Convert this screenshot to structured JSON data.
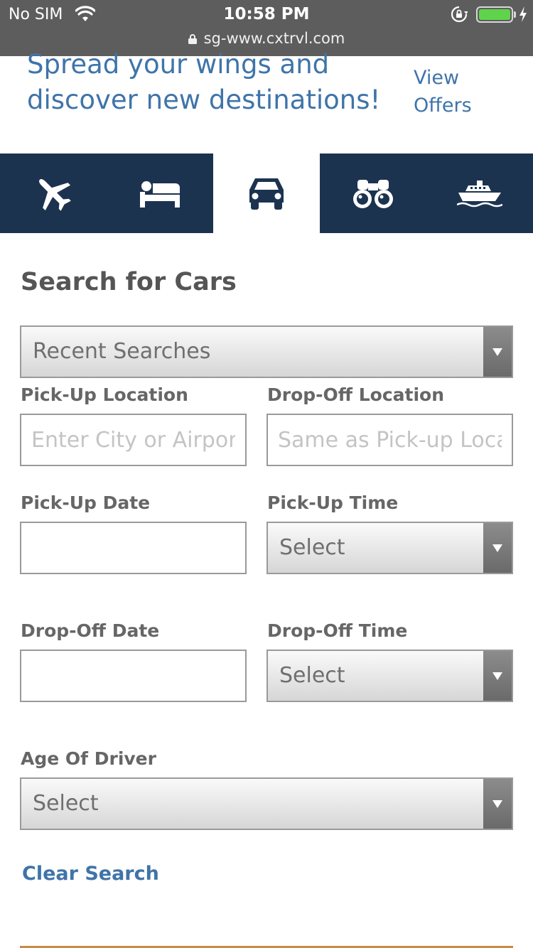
{
  "status_bar": {
    "carrier": "No SIM",
    "time": "10:58 PM",
    "url": "sg-www.cxtrvl.com",
    "colors": {
      "battery": "#5fd34c",
      "background": "#5d5d5d"
    }
  },
  "promo": {
    "text": "Spread your wings and discover new destinations!",
    "link_label": "View Offers",
    "color": "#3f74a9"
  },
  "tabs": [
    {
      "icon": "airplane-icon",
      "active": false
    },
    {
      "icon": "bed-icon",
      "active": false
    },
    {
      "icon": "car-icon",
      "active": true
    },
    {
      "icon": "binoculars-icon",
      "active": false
    },
    {
      "icon": "cruise-ship-icon",
      "active": false
    }
  ],
  "tab_colors": {
    "background": "#1c3350",
    "active_background": "#ffffff",
    "icon_inactive": "#ffffff",
    "icon_active": "#1c3350"
  },
  "form": {
    "heading": "Search for Cars",
    "recent_searches": "Recent Searches",
    "pickup_location": {
      "label": "Pick-Up Location",
      "placeholder": "Enter City or Airport",
      "value": ""
    },
    "dropoff_location": {
      "label": "Drop-Off Location",
      "placeholder": "Same as Pick-up Location",
      "value": ""
    },
    "pickup_date": {
      "label": "Pick-Up Date",
      "value": ""
    },
    "pickup_time": {
      "label": "Pick-Up Time",
      "value": "Select"
    },
    "dropoff_date": {
      "label": "Drop-Off Date",
      "value": ""
    },
    "dropoff_time": {
      "label": "Drop-Off Time",
      "value": "Select"
    },
    "driver_age": {
      "label": "Age Of Driver",
      "value": "Select"
    },
    "clear_label": "Clear Search"
  }
}
